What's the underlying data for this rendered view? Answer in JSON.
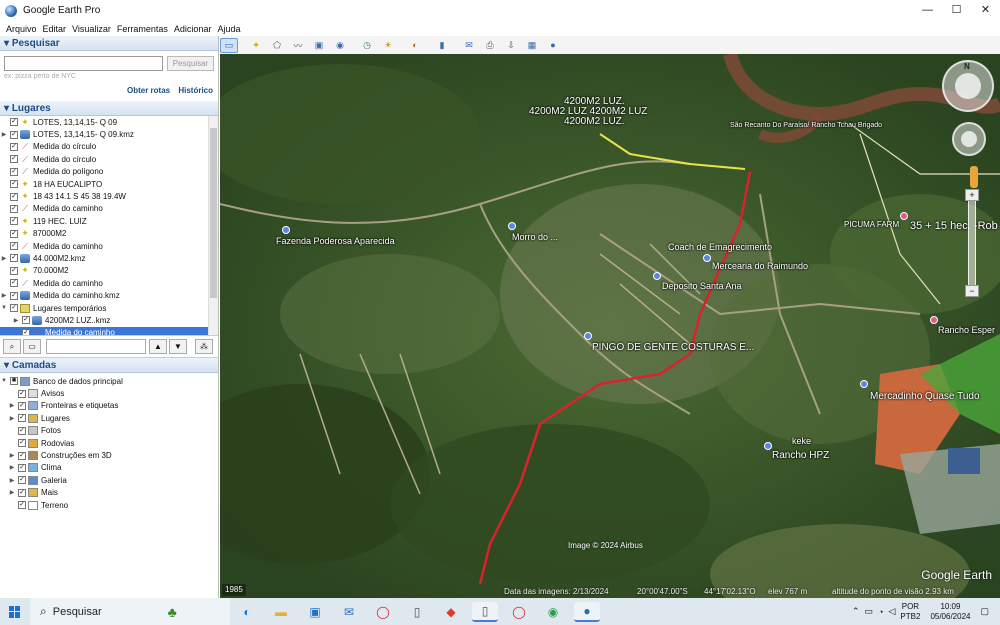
{
  "window": {
    "title": "Google Earth Pro",
    "minimize": "—",
    "maximize": "☐",
    "close": "✕"
  },
  "menu": [
    "Arquivo",
    "Editar",
    "Visualizar",
    "Ferramentas",
    "Adicionar",
    "Ajuda"
  ],
  "search_panel": {
    "header": "Pesquisar",
    "input_value": "",
    "button": "Pesquisar",
    "hint": "ex: pizza perto de NYC",
    "link_routes": "Obter rotas",
    "link_history": "Histórico"
  },
  "places_panel": {
    "header": "Lugares",
    "items": [
      {
        "label": "LOTES, 13,14,15- Q 09",
        "icon": "pin-icon",
        "expand": "",
        "checked": "✓"
      },
      {
        "label": "LOTES, 13,14,15- Q 09.kmz",
        "icon": "kmz-icon",
        "expand": "▶",
        "checked": "✓"
      },
      {
        "label": "Medida do círculo",
        "icon": "ruler-icon",
        "expand": "",
        "checked": "✓"
      },
      {
        "label": "Medida do círculo",
        "icon": "ruler-icon",
        "expand": "",
        "checked": "✓"
      },
      {
        "label": "Medida do polígono",
        "icon": "ruler-icon",
        "expand": "",
        "checked": "✓"
      },
      {
        "label": "18 HA EUCALIPTO",
        "icon": "pin-icon",
        "expand": "",
        "checked": "✓"
      },
      {
        "label": "18 43 14.1 S 45 38 19.4W",
        "icon": "pin-icon",
        "expand": "",
        "checked": "✓"
      },
      {
        "label": "Medida do caminho",
        "icon": "ruler-icon",
        "expand": "",
        "checked": "✓"
      },
      {
        "label": "119 HEC. LUIZ",
        "icon": "pin-icon",
        "expand": "",
        "checked": "✓"
      },
      {
        "label": "87000M2",
        "icon": "pin-icon",
        "expand": "",
        "checked": "✓"
      },
      {
        "label": "Medida do caminho",
        "icon": "ruler-icon",
        "expand": "",
        "checked": "✓"
      },
      {
        "label": "44.000M2.kmz",
        "icon": "kmz-icon",
        "expand": "▶",
        "checked": "✓"
      },
      {
        "label": "70.000M2",
        "icon": "pin-icon",
        "expand": "",
        "checked": "✓"
      },
      {
        "label": "Medida do caminho",
        "icon": "ruler-icon",
        "expand": "",
        "checked": "✓"
      },
      {
        "label": "Medida do caminho.kmz",
        "icon": "kmz-icon",
        "expand": "▶",
        "checked": "✓"
      },
      {
        "label": "Lugares temporários",
        "icon": "folder-icon",
        "expand": "▼",
        "checked": "✓"
      },
      {
        "label": "4200M2 LUZ..kmz",
        "icon": "kmz-icon",
        "expand": "▶",
        "checked": "✓"
      },
      {
        "label": "Medida do caminho",
        "icon": "ruler-icon",
        "expand": "",
        "checked": "✓",
        "selected": true
      }
    ]
  },
  "layers_panel": {
    "header": "Camadas",
    "items": [
      {
        "label": "Banco de dados principal",
        "expand": "▼",
        "checked": "■"
      },
      {
        "label": "Avisos",
        "expand": "",
        "checked": "✓"
      },
      {
        "label": "Fronteiras e etiquetas",
        "expand": "▶",
        "checked": "✓"
      },
      {
        "label": "Lugares",
        "expand": "▶",
        "checked": "✓"
      },
      {
        "label": "Fotos",
        "expand": "",
        "checked": "✓"
      },
      {
        "label": "Rodovias",
        "expand": "",
        "checked": "✓"
      },
      {
        "label": "Construções em 3D",
        "expand": "▶",
        "checked": "✓"
      },
      {
        "label": "Clima",
        "expand": "▶",
        "checked": "✓"
      },
      {
        "label": "Galeria",
        "expand": "▶",
        "checked": "✓"
      },
      {
        "label": "Mais",
        "expand": "▶",
        "checked": "✓"
      },
      {
        "label": "Terreno",
        "expand": "",
        "checked": "✓"
      }
    ]
  },
  "map": {
    "labels": {
      "luz1": "4200M2 LUZ.",
      "luz2": "4200M2 LUZ  4200M2 LUZ",
      "luz3": "4200M2 LUZ.",
      "sao_recanto": "São Recanto Do Paraíso/ Rancho Tchau Brigado",
      "fazenda": "Fazenda Poderosa Aparecida",
      "morro": "Morro do ...",
      "coach": "Coach de Emagrecimento",
      "mercearia": "Mercearia do Raimundo",
      "deposito": "Deposito Santa Ana",
      "pingo": "PINGO DE GENTE COSTURAS E...",
      "picuma": "PICUMA FARM",
      "hec": "35 + 15 hec. -Rob",
      "rancho_esper": "Rancho Esper",
      "mercadinho": "Mercadinho Quase Tudo",
      "keke": "keke",
      "rancho_hpz": "Rancho HPZ",
      "copyright": "Image © 2024 Airbus",
      "ge_logo": "Google Earth"
    },
    "status": {
      "year": "1985",
      "date": "Data das imagens: 2/13/2024",
      "lat": "20°00'47.00\"S",
      "lon": "44°17'02.13\"O",
      "elev": "elev  767 m",
      "alt": "altitude do ponto de visão  2.93 km"
    }
  },
  "taskbar": {
    "search_label": "Pesquisar",
    "lang_top": "POR",
    "lang_bottom": "PTB2",
    "time": "10:09",
    "date": "05/06/2024"
  }
}
